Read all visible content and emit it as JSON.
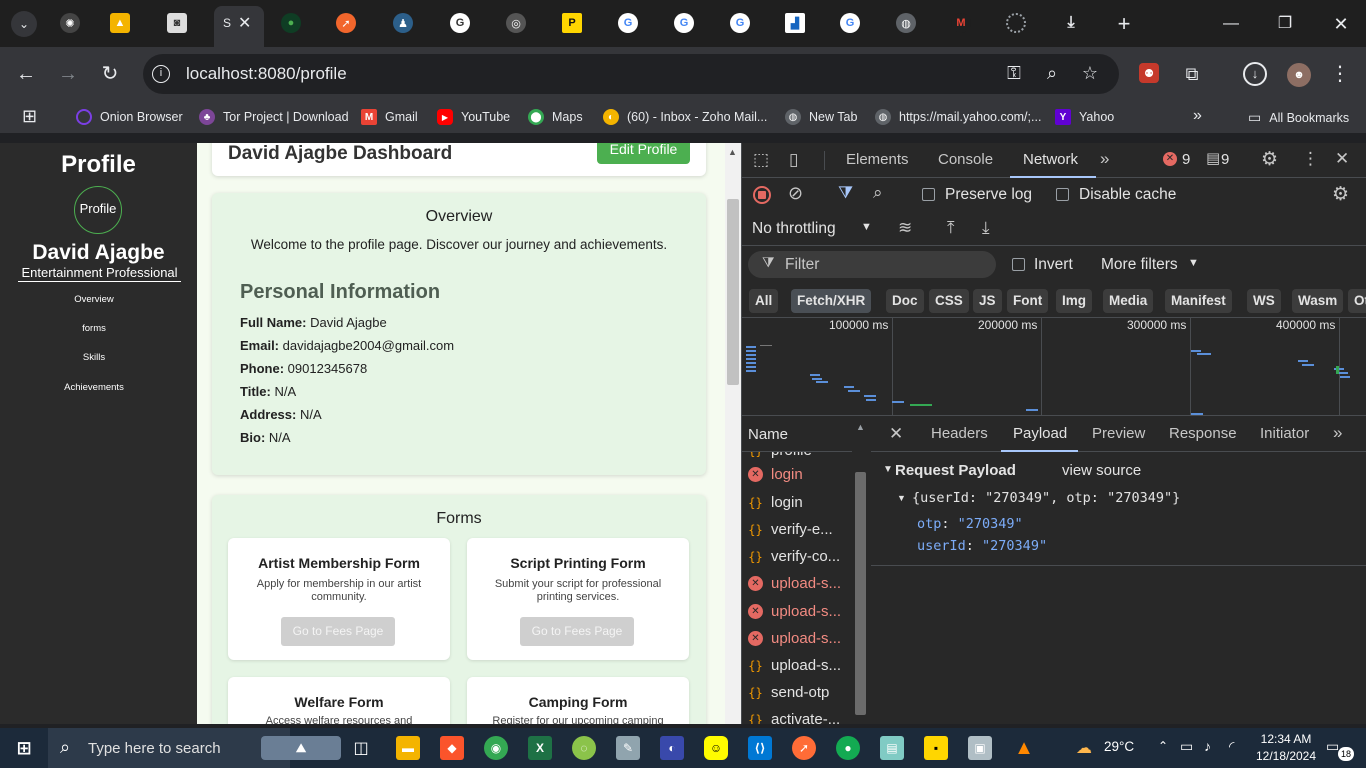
{
  "browser": {
    "url": "localhost:8080/profile",
    "active_tab_label": "S"
  },
  "bookmarks": [
    {
      "label": "Onion Browser",
      "color": "#7b3fe4"
    },
    {
      "label": "Tor Project | Download",
      "color": "#9b59b6"
    },
    {
      "label": "Gmail",
      "color": "#ea4335"
    },
    {
      "label": "YouTube",
      "color": "#ff0000"
    },
    {
      "label": "Maps",
      "color": "#34a853"
    },
    {
      "label": "(60) - Inbox - Zoho Mail...",
      "color": "#f4b400"
    },
    {
      "label": "New Tab",
      "color": "#9aa0a6"
    },
    {
      "label": "https://mail.yahoo.com/;...",
      "color": "#9aa0a6"
    },
    {
      "label": "Yahoo",
      "color": "#6001d2"
    }
  ],
  "all_bookmarks_label": "All Bookmarks",
  "sidebar": {
    "title": "Profile",
    "avatar_alt": "Profile",
    "name": "David Ajagbe",
    "role": "Entertainment Professional",
    "links": [
      "Overview",
      "forms",
      "Skills",
      "Achievements"
    ]
  },
  "header": {
    "title": "David Ajagbe Dashboard",
    "edit_button": "Edit Profile"
  },
  "overview": {
    "title": "Overview",
    "text": "Welcome to the profile page. Discover our journey and achievements."
  },
  "personal": {
    "title": "Personal Information",
    "rows": [
      {
        "label": "Full Name:",
        "value": " David Ajagbe"
      },
      {
        "label": "Email:",
        "value": " davidajagbe2004@gmail.com"
      },
      {
        "label": "Phone:",
        "value": " 09012345678"
      },
      {
        "label": "Title:",
        "value": " N/A"
      },
      {
        "label": "Address:",
        "value": " N/A"
      },
      {
        "label": "Bio:",
        "value": " N/A"
      }
    ]
  },
  "forms": {
    "title": "Forms",
    "cards": [
      {
        "title": "Artist Membership Form",
        "desc": "Apply for membership in our artist community.",
        "button": "Go to Fees Page"
      },
      {
        "title": "Script Printing Form",
        "desc": "Submit your script for professional printing services.",
        "button": "Go to Fees Page"
      },
      {
        "title": "Welfare Form",
        "desc": "Access welfare resources and",
        "button": ""
      },
      {
        "title": "Camping Form",
        "desc": "Register for our upcoming camping",
        "button": ""
      }
    ]
  },
  "devtools": {
    "tabs": [
      "Elements",
      "Console",
      "Network"
    ],
    "active_tab": "Network",
    "error_count": "9",
    "message_count": "9",
    "preserve_log": "Preserve log",
    "disable_cache": "Disable cache",
    "throttling": "No throttling",
    "filter_placeholder": "Filter",
    "invert": "Invert",
    "more_filters": "More filters",
    "type_filters": [
      "All",
      "Fetch/XHR",
      "Doc",
      "CSS",
      "JS",
      "Font",
      "Img",
      "Media",
      "Manifest",
      "WS",
      "Wasm",
      "Ot"
    ],
    "active_type_filter": "Fetch/XHR",
    "timeline_ticks": [
      "100000 ms",
      "200000 ms",
      "300000 ms",
      "400000 ms"
    ],
    "name_header": "Name",
    "requests": [
      {
        "name": "profile",
        "status": "ok"
      },
      {
        "name": "login",
        "status": "error"
      },
      {
        "name": "login",
        "status": "ok"
      },
      {
        "name": "verify-e...",
        "status": "ok"
      },
      {
        "name": "verify-co...",
        "status": "ok"
      },
      {
        "name": "upload-s...",
        "status": "error"
      },
      {
        "name": "upload-s...",
        "status": "error"
      },
      {
        "name": "upload-s...",
        "status": "error"
      },
      {
        "name": "upload-s...",
        "status": "ok"
      },
      {
        "name": "send-otp",
        "status": "ok"
      },
      {
        "name": "activate-...",
        "status": "ok"
      }
    ],
    "detail_tabs": [
      "Headers",
      "Payload",
      "Preview",
      "Response",
      "Initiator"
    ],
    "active_detail_tab": "Payload",
    "payload": {
      "section": "Request Payload",
      "view_source": "view source",
      "summary": "{userId: \"270349\", otp: \"270349\"}",
      "fields": [
        {
          "key": "otp",
          "value": "\"270349\""
        },
        {
          "key": "userId",
          "value": "\"270349\""
        }
      ]
    }
  },
  "taskbar": {
    "search_placeholder": "Type here to search",
    "weather": "29°C",
    "time": "12:34 AM",
    "date": "12/18/2024",
    "notif_count": "18"
  }
}
